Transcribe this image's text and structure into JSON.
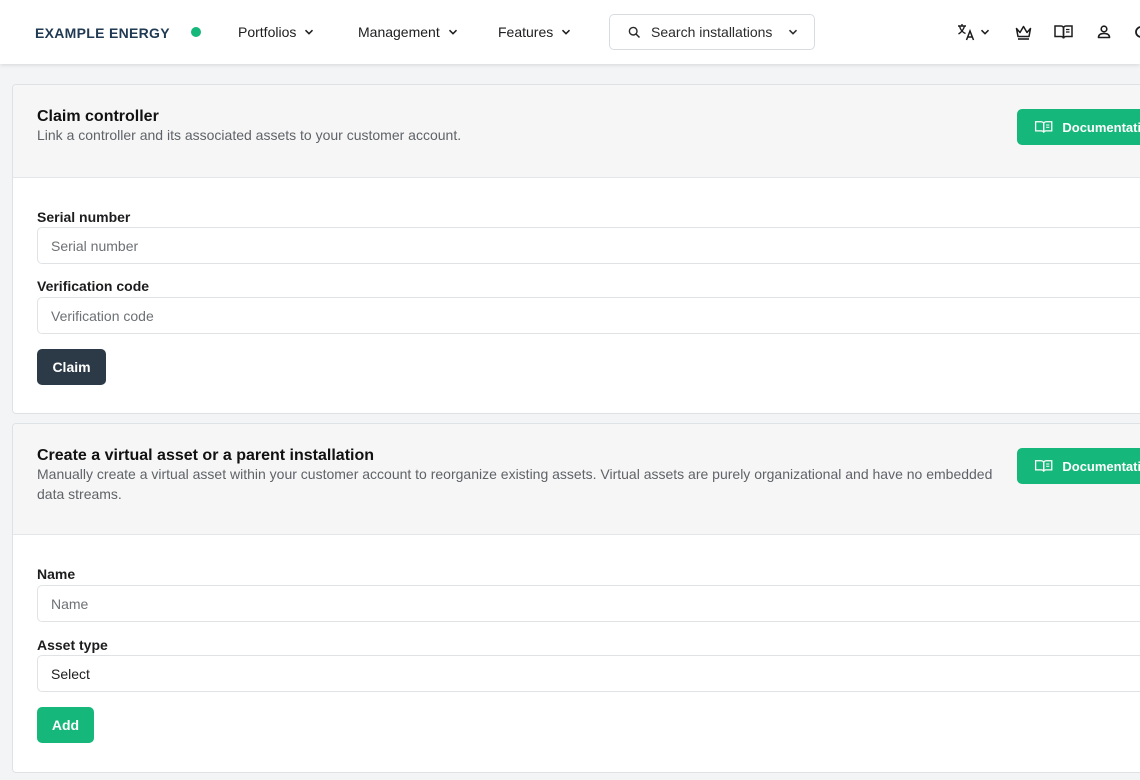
{
  "brand": {
    "name": "EXAMPLE ENERGY",
    "status_color": "#16b77a"
  },
  "nav": {
    "portfolios": "Portfolios",
    "management": "Management",
    "features": "Features",
    "search_label": "Search installations"
  },
  "top_icons": [
    "translate-icon",
    "crown-icon",
    "book-icon",
    "user-icon"
  ],
  "claim": {
    "title": "Claim controller",
    "description": "Link a controller and its associated assets to your customer account.",
    "doc_button": "Documentation",
    "serial_label": "Serial number",
    "serial_placeholder": "Serial number",
    "verification_label": "Verification code",
    "verification_placeholder": "Verification code",
    "submit": "Claim"
  },
  "virtual": {
    "title": "Create a virtual asset or a parent installation",
    "description": "Manually create a virtual asset within your customer account to reorganize existing assets. Virtual assets are purely organizational and have no embedded data streams.",
    "doc_button": "Documentation",
    "name_label": "Name",
    "name_placeholder": "Name",
    "type_label": "Asset type",
    "type_value": "Select",
    "submit": "Add"
  },
  "colors": {
    "accent": "#16b77a",
    "dark_button": "#2c3a48"
  }
}
